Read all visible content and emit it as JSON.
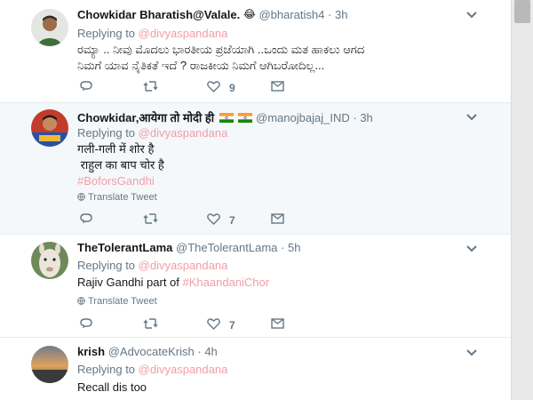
{
  "tweets": [
    {
      "name": "Chowkidar Bharatish@Valale.",
      "emoji": "😂",
      "handle": "@bharatish4",
      "dot": "·",
      "time": "3h",
      "replying_prefix": "Replying to",
      "replying_to": "@divyaspandana",
      "text_lines": [
        "ರಮ್ಯಾ .. ನೀವು ಮೊದಲು ಭಾರತೀಯ ಪ್ರಜೆಯಾಗಿ ..ಒಂದು ಮತ ಹಾಕಲು ಆಗದ",
        "ನಿಮಗೆ ಯಾವ ನೈತಿಕತೆ ಇದೆ ? ರಾಜಕೀಯ ನಿಮಗೆ ಆಗಿಬರೋದಿಲ್ಲ..."
      ],
      "like_count": "9"
    },
    {
      "name": "Chowkidar,आयेगा तो मोदी ही",
      "flag_icons": [
        "india-flag-icon",
        "india-flag-icon"
      ],
      "handle": "@manojbajaj_IND",
      "dot": "·",
      "time": "3h",
      "replying_prefix": "Replying to",
      "replying_to": "@divyaspandana",
      "text_lines": [
        "गली-गली में शोर है",
        " राहुल का बाप चोर है"
      ],
      "hashtag": "#BoforsGandhi",
      "translate": "Translate Tweet",
      "like_count": "7"
    },
    {
      "name": "TheTolerantLama",
      "handle": "@TheTolerantLama",
      "dot": "·",
      "time": "5h",
      "replying_prefix": "Replying to",
      "replying_to": "@divyaspandana",
      "text_prefix": "Rajiv Gandhi part of ",
      "hashtag": "#KhaandaniChor",
      "translate": "Translate Tweet",
      "like_count": "7"
    },
    {
      "name": "krish",
      "handle": "@AdvocateKrish",
      "dot": "·",
      "time": "4h",
      "replying_prefix": "Replying to",
      "replying_to": "@divyaspandana",
      "text": "Recall dis too"
    }
  ],
  "colors": {
    "link": "#f29cab",
    "muted": "#657786",
    "text": "#14171a",
    "highlight_bg": "#f5f8fa"
  },
  "icons": [
    "reply-icon",
    "retweet-icon",
    "like-icon",
    "message-icon",
    "chevron-down-icon",
    "globe-icon"
  ]
}
